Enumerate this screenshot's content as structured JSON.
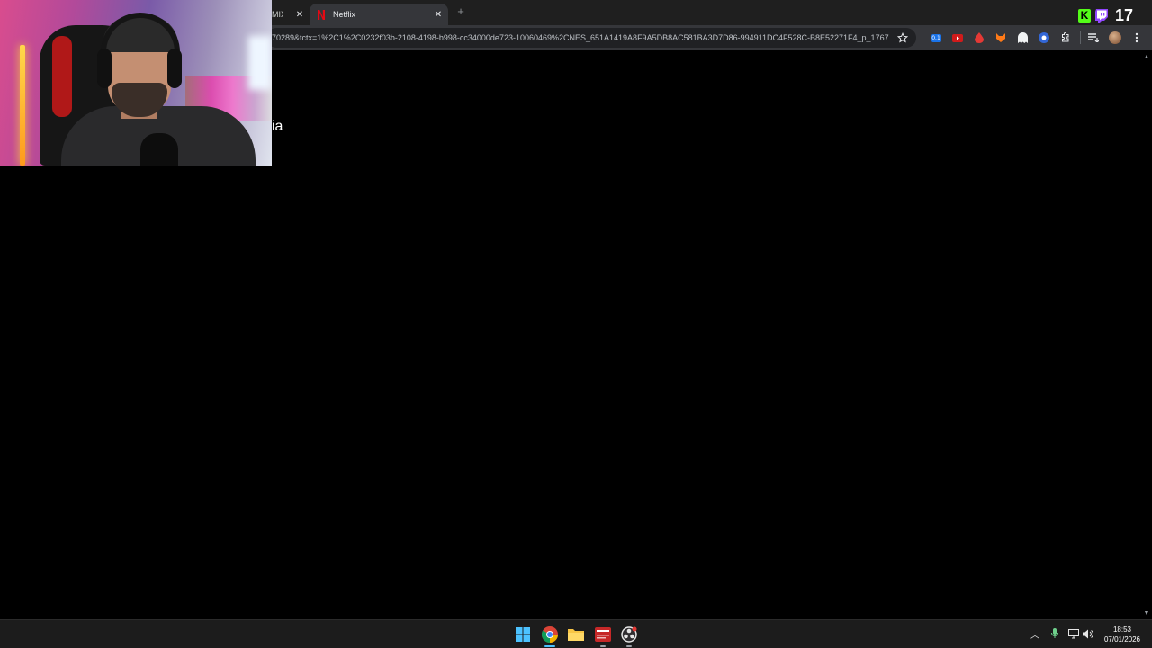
{
  "browser": {
    "tabs": [
      {
        "label": "MIX |",
        "active": false
      },
      {
        "label": "Netflix",
        "active": true
      }
    ],
    "url": "70289&tctx=1%2C1%2C0232f03b-2108-4198-b998-cc34000de723-10060469%2CNES_651A1419A8F9A5DB8AC581BA3D7D86-994911DC4F528C-B8E52271F4_p_1767...",
    "extensions": [
      {
        "name": "counter-extension-icon",
        "badge": "0.1"
      },
      {
        "name": "youtube-extension-icon"
      },
      {
        "name": "red-drop-extension-icon"
      },
      {
        "name": "fox-extension-icon"
      },
      {
        "name": "ghost-extension-icon"
      },
      {
        "name": "blue-circle-extension-icon"
      },
      {
        "name": "puzzle-extensions-icon"
      },
      {
        "name": "media-control-icon"
      },
      {
        "name": "profile-avatar-icon"
      },
      {
        "name": "kebab-menu-icon"
      }
    ]
  },
  "page": {
    "text_fragment": "ia"
  },
  "overlay": {
    "viewer_count": "17",
    "platforms": [
      "kick-icon",
      "twitch-icon"
    ],
    "kick_letter": "K"
  },
  "taskbar": {
    "apps": [
      "windows-start-icon",
      "chrome-icon",
      "file-explorer-icon",
      "netflix-tv-app-icon",
      "obs-icon"
    ],
    "clock": {
      "time": "18:53",
      "date": "07/01/2026"
    }
  },
  "colors": {
    "tab_active": "#35363a",
    "tabstrip": "#1f1f1f",
    "kick_green": "#53fc18",
    "twitch_purple": "#9146ff",
    "netflix_red": "#e50914"
  }
}
